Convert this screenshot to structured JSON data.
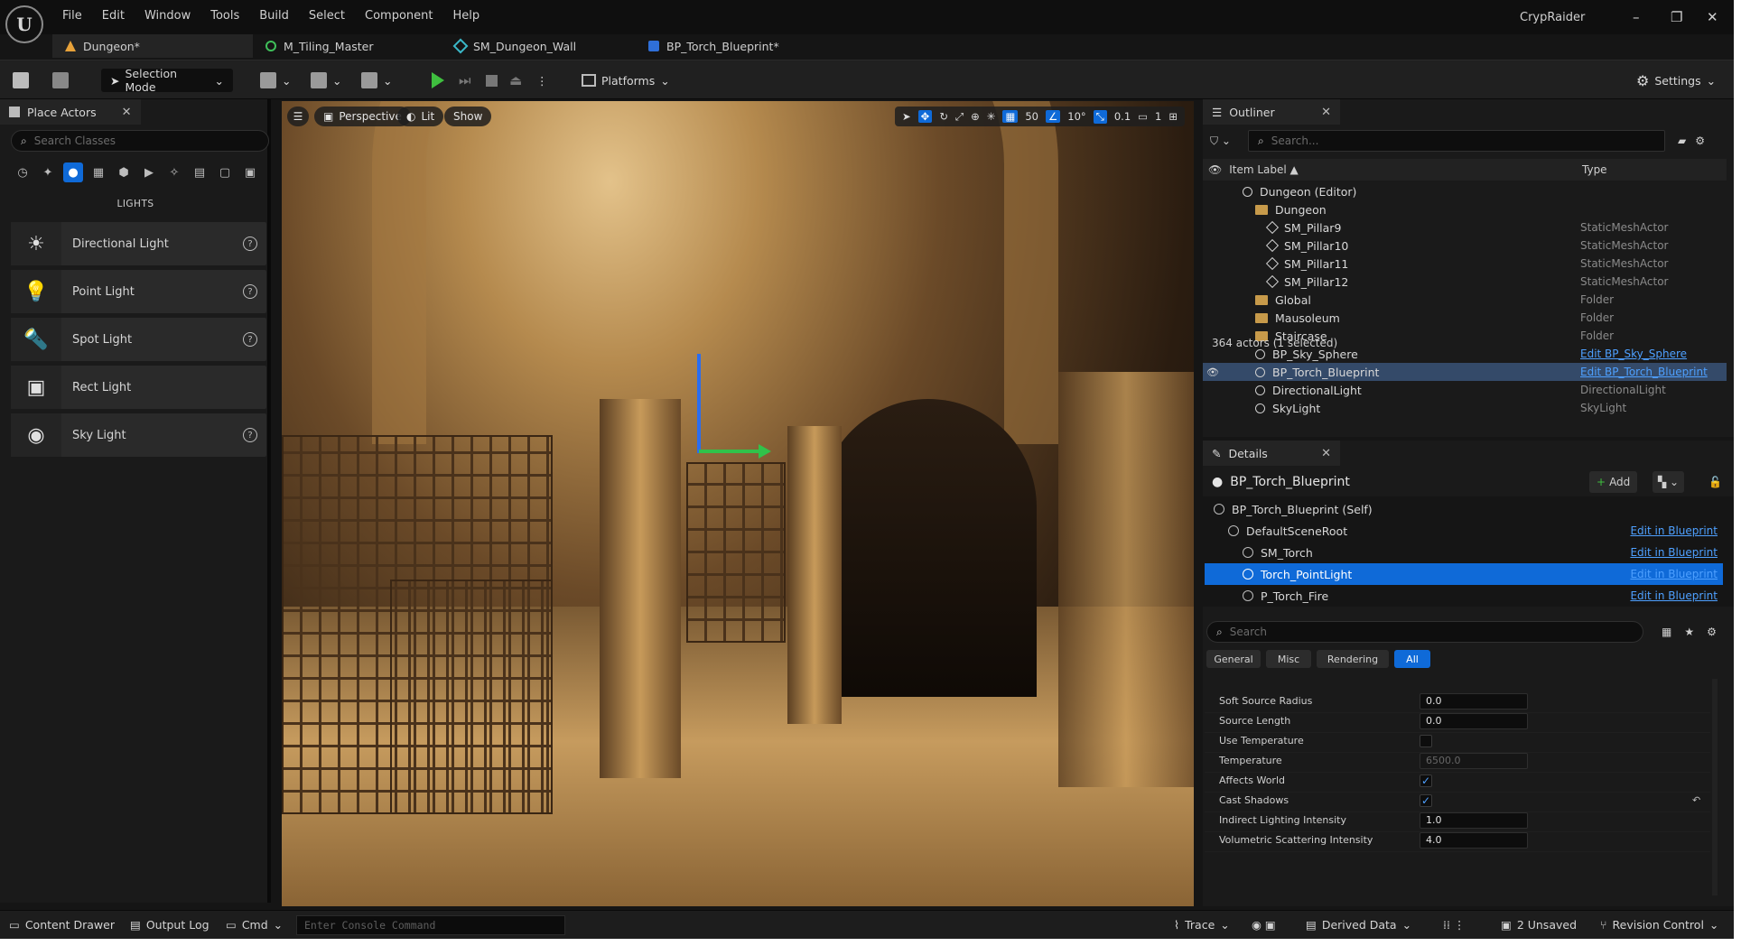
{
  "app": {
    "logo_letter": "U",
    "menu": [
      "File",
      "Edit",
      "Window",
      "Tools",
      "Build",
      "Select",
      "Component",
      "Help"
    ],
    "project_name": "CrypRaider",
    "window_controls": [
      "–",
      "❐",
      "✕"
    ]
  },
  "tabs": [
    {
      "label": "Dungeon*",
      "icon": "level-icon",
      "active": true
    },
    {
      "label": "M_Tiling_Master",
      "icon": "material-icon",
      "active": false
    },
    {
      "label": "SM_Dungeon_Wall",
      "icon": "static-mesh-icon",
      "active": false
    },
    {
      "label": "BP_Torch_Blueprint*",
      "icon": "blueprint-icon",
      "active": false
    }
  ],
  "toolbar": {
    "selection_mode": "Selection Mode",
    "platforms": "Platforms",
    "settings": "Settings"
  },
  "place_actors": {
    "tab_label": "Place Actors",
    "close": "✕",
    "search_placeholder": "Search Classes",
    "category_label": "LIGHTS",
    "items": [
      {
        "label": "Directional Light",
        "icon": "directional-light-icon",
        "glyph": "☀"
      },
      {
        "label": "Point Light",
        "icon": "point-light-icon",
        "glyph": "💡"
      },
      {
        "label": "Spot Light",
        "icon": "spot-light-icon",
        "glyph": "🔦"
      },
      {
        "label": "Rect Light",
        "icon": "rect-light-icon",
        "glyph": "▣"
      },
      {
        "label": "Sky Light",
        "icon": "sky-light-icon",
        "glyph": "◉"
      }
    ],
    "help_glyph": "?"
  },
  "viewport": {
    "view_mode": "Perspective",
    "lighting_mode": "Lit",
    "show_label": "Show",
    "grid_snap": "50",
    "rotation_snap": "10°",
    "scale_snap": "0.1",
    "camera_speed": "1"
  },
  "outliner": {
    "tab_label": "Outliner",
    "close": "✕",
    "search_placeholder": "Search...",
    "col_label": "Item Label ▲",
    "col_type": "Type",
    "rows": [
      {
        "label": "Dungeon (Editor)",
        "type": "",
        "indent": 0,
        "kind": "level"
      },
      {
        "label": "Dungeon",
        "type": "",
        "indent": 1,
        "kind": "folder"
      },
      {
        "label": "SM_Pillar9",
        "type": "StaticMeshActor",
        "indent": 2,
        "kind": "mesh"
      },
      {
        "label": "SM_Pillar10",
        "type": "StaticMeshActor",
        "indent": 2,
        "kind": "mesh"
      },
      {
        "label": "SM_Pillar11",
        "type": "StaticMeshActor",
        "indent": 2,
        "kind": "mesh"
      },
      {
        "label": "SM_Pillar12",
        "type": "StaticMeshActor",
        "indent": 2,
        "kind": "mesh"
      },
      {
        "label": "Global",
        "type": "Folder",
        "indent": 1,
        "kind": "folder"
      },
      {
        "label": "Mausoleum",
        "type": "Folder",
        "indent": 1,
        "kind": "folder"
      },
      {
        "label": "Staircase",
        "type": "Folder",
        "indent": 1,
        "kind": "folder"
      },
      {
        "label": "BP_Sky_Sphere",
        "type": "Edit BP_Sky_Sphere",
        "indent": 1,
        "kind": "bp"
      },
      {
        "label": "BP_Torch_Blueprint",
        "type": "Edit BP_Torch_Blueprint",
        "indent": 1,
        "kind": "bp",
        "selected": true
      },
      {
        "label": "DirectionalLight",
        "type": "DirectionalLight",
        "indent": 1,
        "kind": "light"
      },
      {
        "label": "SkyLight",
        "type": "SkyLight",
        "indent": 1,
        "kind": "light"
      }
    ],
    "status": "364 actors (1 selected)"
  },
  "details": {
    "tab_label": "Details",
    "close": "✕",
    "actor_name": "BP_Torch_Blueprint",
    "add_label": "Add",
    "components": [
      {
        "label": "BP_Torch_Blueprint (Self)",
        "indent": 0,
        "edit": ""
      },
      {
        "label": "DefaultSceneRoot",
        "indent": 1,
        "edit": "Edit in Blueprint"
      },
      {
        "label": "SM_Torch",
        "indent": 2,
        "edit": "Edit in Blueprint"
      },
      {
        "label": "Torch_PointLight",
        "indent": 2,
        "edit": "Edit in Blueprint",
        "selected": true
      },
      {
        "label": "P_Torch_Fire",
        "indent": 2,
        "edit": "Edit in Blueprint"
      }
    ],
    "search_placeholder": "Search",
    "filters": [
      "General",
      "Misc",
      "Rendering",
      "All"
    ],
    "properties": [
      {
        "name": "Soft Source Radius",
        "kind": "num",
        "value": "0.0"
      },
      {
        "name": "Source Length",
        "kind": "num",
        "value": "0.0"
      },
      {
        "name": "Use Temperature",
        "kind": "check",
        "checked": false
      },
      {
        "name": "Temperature",
        "kind": "num",
        "value": "6500.0",
        "dim": true
      },
      {
        "name": "Affects World",
        "kind": "check",
        "checked": true
      },
      {
        "name": "Cast Shadows",
        "kind": "check",
        "checked": true
      },
      {
        "name": "Indirect Lighting Intensity",
        "kind": "num",
        "value": "1.0"
      },
      {
        "name": "Volumetric Scattering Intensity",
        "kind": "num",
        "value": "4.0"
      }
    ]
  },
  "bottom": {
    "content_drawer": "Content Drawer",
    "output_log": "Output Log",
    "cmd": "Cmd",
    "console_placeholder": "Enter Console Command",
    "trace": "Trace",
    "derived_data": "Derived Data",
    "unsaved": "2 Unsaved",
    "revision_control": "Revision Control"
  },
  "colors": {
    "accent": "#0f6ad8",
    "link": "#4ea0ff",
    "play_green": "#3fbf3f",
    "panel_bg": "#1a1a1a"
  }
}
